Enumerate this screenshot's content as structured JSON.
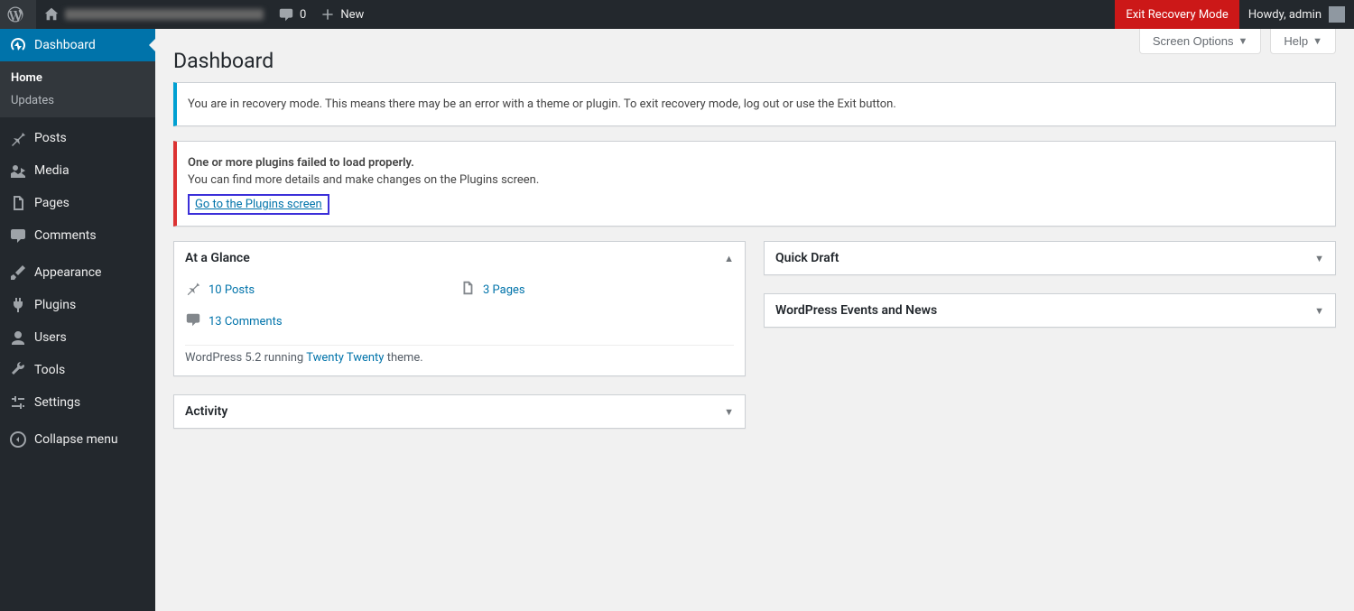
{
  "adminbar": {
    "comments_count": "0",
    "new_label": "New",
    "exit_recovery": "Exit Recovery Mode",
    "howdy": "Howdy, admin"
  },
  "menu": {
    "dashboard": "Dashboard",
    "home": "Home",
    "updates": "Updates",
    "posts": "Posts",
    "media": "Media",
    "pages": "Pages",
    "comments": "Comments",
    "appearance": "Appearance",
    "plugins": "Plugins",
    "users": "Users",
    "tools": "Tools",
    "settings": "Settings",
    "collapse": "Collapse menu"
  },
  "screen_meta": {
    "screen_options": "Screen Options",
    "help": "Help"
  },
  "page_title": "Dashboard",
  "notice_info": {
    "text": "You are in recovery mode. This means there may be an error with a theme or plugin. To exit recovery mode, log out or use the Exit button."
  },
  "notice_error": {
    "heading": "One or more plugins failed to load properly.",
    "detail": "You can find more details and make changes on the Plugins screen.",
    "link": "Go to the Plugins screen"
  },
  "widgets": {
    "glance": {
      "title": "At a Glance",
      "posts": "10 Posts",
      "pages": "3 Pages",
      "comments": "13 Comments",
      "version_pre": "WordPress 5.2 running ",
      "theme": "Twenty Twenty",
      "version_post": " theme."
    },
    "activity": {
      "title": "Activity"
    },
    "quickdraft": {
      "title": "Quick Draft"
    },
    "news": {
      "title": "WordPress Events and News"
    }
  }
}
